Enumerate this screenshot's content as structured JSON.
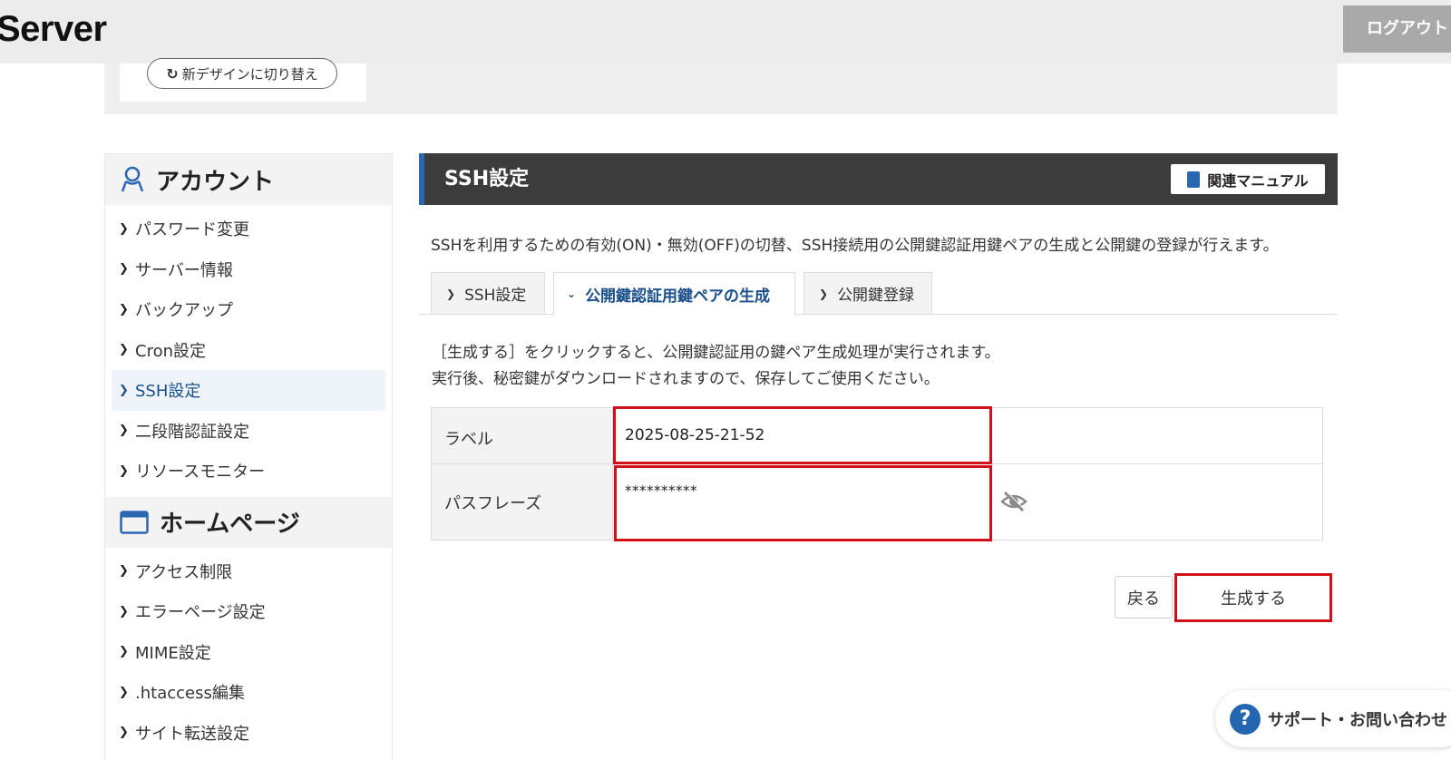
{
  "header": {
    "logo": "Server",
    "logout_label": "ログアウト"
  },
  "band": {
    "design_switch_label": "新デザインに切り替え"
  },
  "sidebar": {
    "account_heading": "アカウント",
    "account_items": [
      {
        "label": "パスワード変更"
      },
      {
        "label": "サーバー情報"
      },
      {
        "label": "バックアップ"
      },
      {
        "label": "Cron設定"
      },
      {
        "label": "SSH設定",
        "active": true
      },
      {
        "label": "二段階認証設定"
      },
      {
        "label": "リソースモニター"
      }
    ],
    "homepage_heading": "ホームページ",
    "homepage_items": [
      {
        "label": "アクセス制限"
      },
      {
        "label": "エラーページ設定"
      },
      {
        "label": "MIME設定"
      },
      {
        "label": ".htaccess編集"
      },
      {
        "label": "サイト転送設定"
      }
    ]
  },
  "main": {
    "title": "SSH設定",
    "manual_label": "関連マニュアル",
    "description": "SSHを利用するための有効(ON)・無効(OFF)の切替、SSH接続用の公開鍵認証用鍵ペアの生成と公開鍵の登録が行えます。",
    "tabs": [
      {
        "label": "SSH設定"
      },
      {
        "label": "公開鍵認証用鍵ペアの生成",
        "active": true
      },
      {
        "label": "公開鍵登録"
      }
    ],
    "info_line1": "［生成する］をクリックすると、公開鍵認証用の鍵ペア生成処理が実行されます。",
    "info_line2": "実行後、秘密鍵がダウンロードされますので、保存してご使用ください。",
    "form": {
      "label_title": "ラベル",
      "label_value": "2025-08-25-21-52",
      "passphrase_title": "パスフレーズ",
      "passphrase_value": "**********"
    },
    "back_label": "戻る",
    "generate_label": "生成する"
  },
  "support": {
    "label": "サポート・お問い合わせ"
  },
  "colors": {
    "accent_blue": "#2b66b0",
    "highlight_red": "#d0101b",
    "header_dark": "#3c3c3c"
  }
}
